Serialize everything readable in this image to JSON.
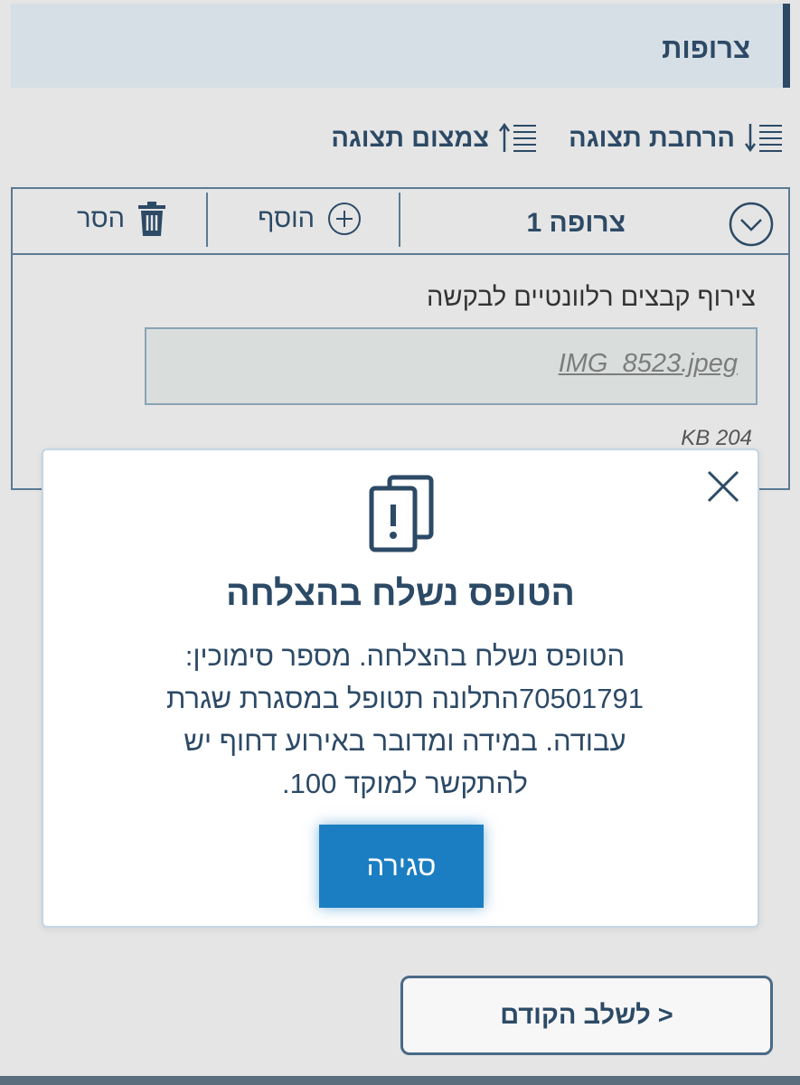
{
  "section": {
    "title": "צרופות"
  },
  "view_toggles": {
    "expand_label": "הרחבת תצוגה",
    "collapse_label": "צמצום תצוגה"
  },
  "attachment_group": {
    "label": "צרופה 1",
    "add_label": "הוסף",
    "remove_label": "הסר",
    "description": "צירוף קבצים רלוונטיים לבקשה",
    "file_name": "IMG_8523.jpeg",
    "file_size": "KB 204"
  },
  "modal": {
    "title": "הטופס נשלח בהצלחה",
    "body_lines": [
      "הטופס נשלח בהצלחה. מספר סימוכין:",
      "70501791התלונה תטופל במסגרת שגרת",
      "עבודה. במידה ומדובר באירוע דחוף יש",
      "להתקשר למוקד 100."
    ],
    "close_button_label": "סגירה"
  },
  "navigation": {
    "prev_label": "< לשלב הקודם"
  },
  "colors": {
    "primary": "#2c4a66",
    "accent_button": "#1c7ec2",
    "header_bg": "#d6dfe5",
    "page_bg": "#e5e5e5"
  }
}
